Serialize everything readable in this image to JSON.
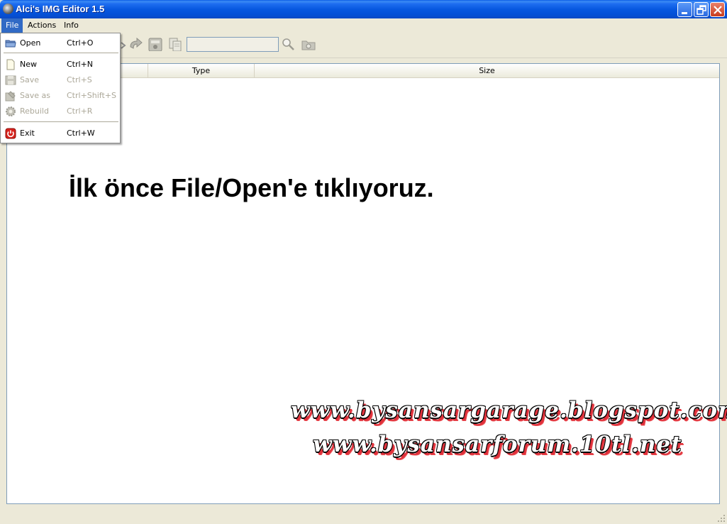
{
  "window": {
    "title": "Alci's IMG Editor 1.5"
  },
  "menubar": {
    "items": [
      "File",
      "Actions",
      "Info"
    ],
    "active": "File"
  },
  "toolbar": {
    "search_value": ""
  },
  "file_menu": {
    "items": [
      {
        "label": "Open",
        "shortcut": "Ctrl+O",
        "icon": "folder-open-icon",
        "enabled": true
      },
      {
        "label": "New",
        "shortcut": "Ctrl+N",
        "icon": "new-file-icon",
        "enabled": true
      },
      {
        "label": "Save",
        "shortcut": "Ctrl+S",
        "icon": "floppy-disk-icon",
        "enabled": false
      },
      {
        "label": "Save as",
        "shortcut": "Ctrl+Shift+S",
        "icon": "save-as-icon",
        "enabled": false
      },
      {
        "label": "Rebuild",
        "shortcut": "Ctrl+R",
        "icon": "gear-icon",
        "enabled": false
      },
      {
        "label": "Exit",
        "shortcut": "Ctrl+W",
        "icon": "power-icon",
        "enabled": true
      }
    ]
  },
  "list": {
    "columns": [
      "Type",
      "Size"
    ]
  },
  "instruction": "İlk önce File/Open'e tıklıyoruz.",
  "watermark": {
    "line1": "www.bysansargarage.blogspot.com",
    "line2": "www.bysansarforum.10tl.net"
  },
  "colors": {
    "menu_highlight": "#316ac5",
    "titlebar": "#0758e0",
    "watermark_shadow": "#e0303a"
  }
}
